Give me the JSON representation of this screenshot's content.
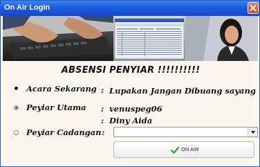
{
  "window": {
    "title": "On Air Login"
  },
  "heading": "ABSENSI PENYIAR !!!!!!!!!!",
  "fields": {
    "acara": {
      "label": "Acara Sekarang",
      "separator": ":",
      "value": "Lupakan Jangan Dibuang sayang (L"
    },
    "utama": {
      "label": "Peyiar Utama",
      "separator": ":",
      "value1": "venuspeg06",
      "value2_sep": ":",
      "value2": "Diny Aida"
    },
    "cadangan": {
      "label": "Peyiar Cadangan",
      "separator": ":",
      "selected": ""
    }
  },
  "button": {
    "label": "ON AIR"
  },
  "icons": {
    "close": "close-icon",
    "check": "check-icon",
    "dropdown": "chevron-down-icon"
  },
  "colors": {
    "titlebar": "#1c5be0",
    "background": "#fbf7ee",
    "check": "#3aa63a"
  }
}
